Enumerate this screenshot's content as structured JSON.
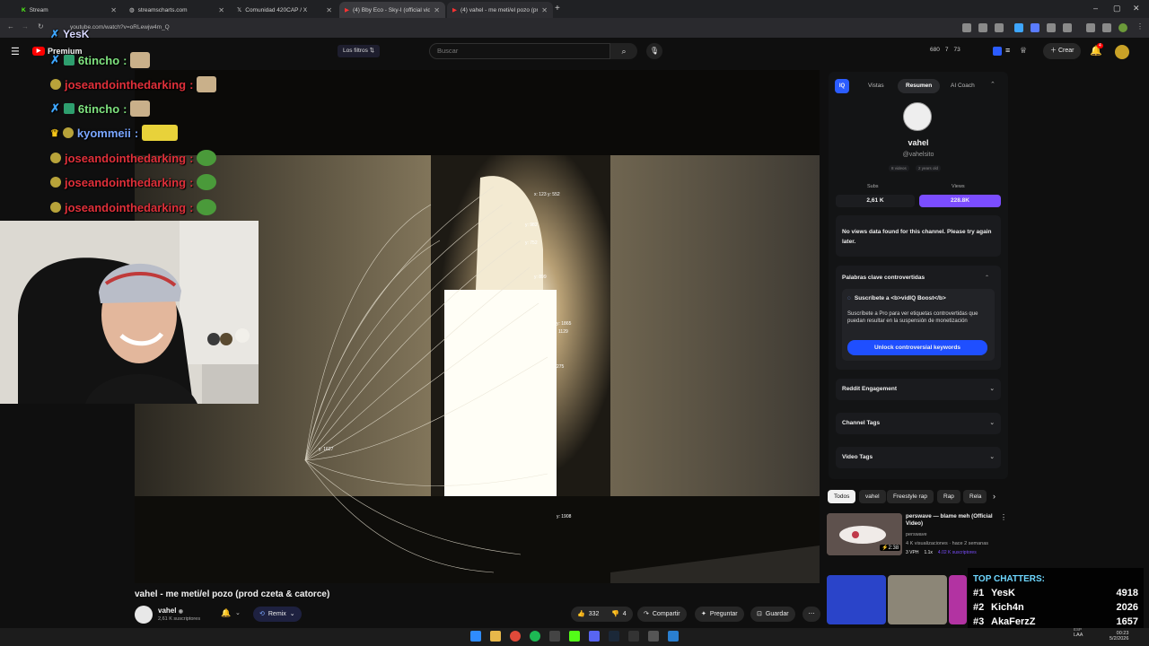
{
  "browser": {
    "tabs": [
      {
        "label": "Stream",
        "active": false
      },
      {
        "label": "streamscharts.com",
        "active": false
      },
      {
        "label": "Comunidad 420CAP / X",
        "active": false
      },
      {
        "label": "(4) Bby Eco - Sky-I (official vide",
        "active": true
      },
      {
        "label": "(4) vahel - me meti/el pozo (pr",
        "active": false
      }
    ],
    "url": "youtube.com/watch?v=oRLewjw4m_Q",
    "new_tab": "+"
  },
  "youtube": {
    "logo": "Premium",
    "filters": "Los filtros",
    "search_placeholder": "Buscar",
    "header_stats": [
      "680",
      "7",
      "73"
    ],
    "create": "Crear",
    "notif_count": "4"
  },
  "chat_overlay": [
    {
      "name": "6tincho",
      "color": "#7fe37f",
      "sep": ":"
    },
    {
      "name": "joseandointhedarking",
      "color": "#e0303a",
      "sep": ":"
    },
    {
      "name": "6tincho",
      "color": "#7fe37f",
      "sep": ":"
    },
    {
      "name": "kyommeii",
      "color": "#7aa6ff",
      "sep": ":"
    },
    {
      "name": "joseandointhedarking",
      "color": "#e0303a",
      "sep": ":"
    },
    {
      "name": "joseandointhedarking",
      "color": "#e0303a",
      "sep": ":"
    },
    {
      "name": "joseandointhedarking",
      "color": "#e0303a",
      "sep": ":"
    }
  ],
  "overlay_top": "YesK",
  "video": {
    "title": "vahel - me meti/el pozo (prod czeta & catorce)",
    "channel": "vahel",
    "subs": "2,61 K suscriptores",
    "remix": "Remix",
    "likes": "332",
    "dislikes": "4",
    "share": "Compartir",
    "ask": "Preguntar",
    "save": "Guardar",
    "overlay_labels": [
      "x: 123  y: 552",
      "y: 982",
      "y: 752",
      "y: 899",
      "y: 1865",
      "1129",
      "275",
      "y: 1627",
      "y: 1908"
    ]
  },
  "vidiq": {
    "tabs": [
      "Vistas",
      "Resumen",
      "AI Coach"
    ],
    "logo": "IQ",
    "channel_name": "vahel",
    "handle": "@vahelsito",
    "meta": [
      "8 videos",
      "2 years old"
    ],
    "subs_label": "Subs",
    "views_label": "Views",
    "subs_value": "2,61 K",
    "views_value": "228.8K",
    "no_views_msg": "No views data found for this channel. Please try again later.",
    "sections": {
      "keywords_title": "Palabras clave controvertidas",
      "promo_title": "Suscríbete a <b>vidIQ Boost</b>",
      "promo_body": "Suscríbete a Pro para ver etiquetas controvertidas que puedan resultar en la suspensión de monetización",
      "unlock": "Unlock controversial keywords",
      "reddit": "Reddit Engagement",
      "channel_tags": "Channel Tags",
      "video_tags": "Video Tags"
    }
  },
  "chips": [
    "Todos",
    "vahel",
    "Freestyle rap",
    "Rap",
    "Rela"
  ],
  "related": {
    "title": "perswave — blame meh (Official Video)",
    "channel": "perswave",
    "meta": "4 K visualizaciones · hace 2 semanas",
    "stats": [
      "3 VPH",
      "1.1x",
      "4.02 K suscriptores"
    ],
    "duration": "2:38"
  },
  "top_chatters": {
    "title": "TOP CHATTERS:",
    "rows": [
      {
        "rank": "#1",
        "name": "YesK",
        "count": "4918"
      },
      {
        "rank": "#2",
        "name": "Kich4n",
        "count": "2026"
      },
      {
        "rank": "#3",
        "name": "AkaFerzZ",
        "count": "1657"
      }
    ]
  },
  "taskbar": {
    "lang": "LAA",
    "lang2": "ESP",
    "time": "00:23",
    "date": "5/2/2026"
  }
}
